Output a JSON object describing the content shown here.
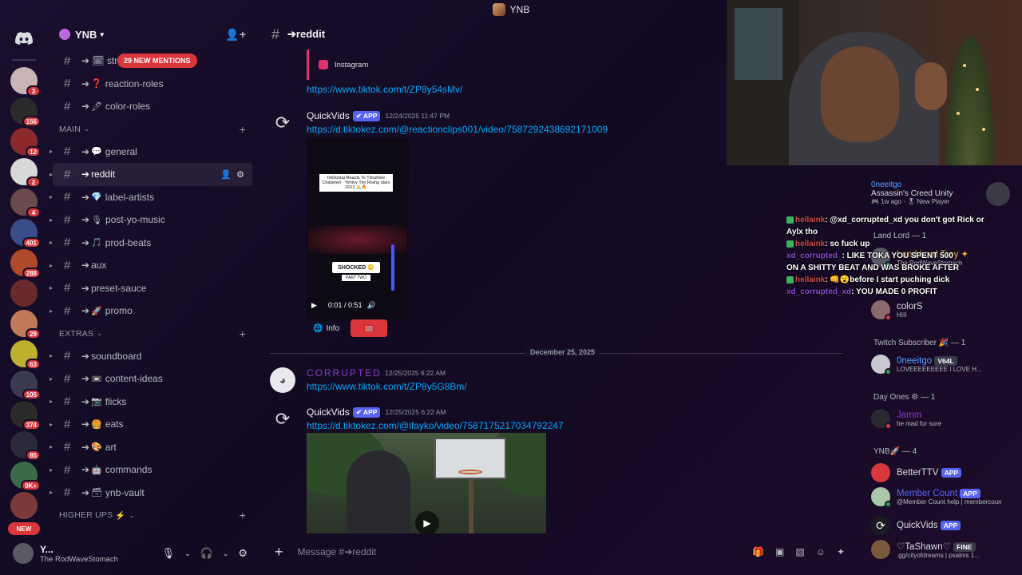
{
  "window": {
    "title": "YNB"
  },
  "rail": {
    "servers": [
      {
        "badge": "3",
        "color": "#c9b5b5"
      },
      {
        "badge": "156",
        "color": "#2b2b2b"
      },
      {
        "badge": "12",
        "color": "#8a2a2a"
      },
      {
        "badge": "2",
        "color": "#d8d8d8"
      },
      {
        "badge": "4",
        "color": "#6a4a4a"
      },
      {
        "badge": "401",
        "color": "#3a4c8a"
      },
      {
        "badge": "288",
        "color": "#b04a2a"
      },
      {
        "badge": "",
        "color": "#6a2a2a"
      },
      {
        "badge": "29",
        "color": "#c07a5a"
      },
      {
        "badge": "63",
        "color": "#c0b030"
      },
      {
        "badge": "105",
        "color": "#3a3a50"
      },
      {
        "badge": "374",
        "color": "#2a2a2a"
      },
      {
        "badge": "85",
        "color": "#2a2a3a"
      },
      {
        "badge": "9K+",
        "color": "#3a6a4a"
      },
      {
        "badge": "",
        "color": "#7a3a3a"
      }
    ],
    "new_label": "NEW"
  },
  "sidebar": {
    "server_name": "YNB",
    "mentions_pill": "29 NEW MENTIONS",
    "top_channels": [
      {
        "emoji": "🗓",
        "name": "➔ 🗓 stre..."
      },
      {
        "emoji": "❓",
        "name": "reaction-roles"
      },
      {
        "emoji": "🖊",
        "name": "color-roles"
      }
    ],
    "categories": {
      "main": "MAIN",
      "extras": "EXTRAS",
      "higher_ups": "HIGHER UPS"
    },
    "main_channels": [
      {
        "emoji": "💬",
        "name": "general"
      },
      {
        "emoji": "",
        "name": "reddit"
      },
      {
        "emoji": "💎",
        "name": "label-artists"
      },
      {
        "emoji": "🎙",
        "name": "post-yo-music"
      },
      {
        "emoji": "🎵",
        "name": "prod-beats"
      },
      {
        "emoji": "",
        "name": "aux"
      },
      {
        "emoji": "",
        "name": "preset-sauce"
      },
      {
        "emoji": "🚀",
        "name": "promo"
      }
    ],
    "extras_channels": [
      {
        "emoji": "",
        "name": "soundboard"
      },
      {
        "emoji": "📼",
        "name": "content-ideas"
      },
      {
        "emoji": "📷",
        "name": "flicks"
      },
      {
        "emoji": "🍔",
        "name": "eats"
      },
      {
        "emoji": "🎨",
        "name": "art"
      },
      {
        "emoji": "🤖",
        "name": "commands"
      },
      {
        "emoji": "🗃",
        "name": "ynb-vault"
      }
    ]
  },
  "user": {
    "name": "Y...",
    "status": "The RodWaveStomach"
  },
  "channel": {
    "name": "➔reddit"
  },
  "messages": {
    "ig_embed_label": "Instagram",
    "link1": "https://www.tiktok.com/t/ZP8y54sMv/",
    "msg1": {
      "author": "QuickVids",
      "tag": "APP",
      "time": "12/24/2025 11:47 PM",
      "link": "https://d.tiktokez.com/@reactionclips001/video/7587292438692171009"
    },
    "video1": {
      "caption": "ImDontai Reacts To Timothée Chalamet - Timmy Tim Rising stars 2012 🙏🔥",
      "shocked": "SHOCKED 😳",
      "part": "PART TWO",
      "time": "0:01 / 0:51",
      "info_label": "Info"
    },
    "date_divider": "December 25, 2025",
    "msg2": {
      "author": "CORRUPTED",
      "time": "12/25/2025 6:22 AM",
      "link": "https://www.tiktok.com/t/ZP8y5G8Bm/"
    },
    "msg3": {
      "author": "QuickVids",
      "tag": "APP",
      "time": "12/25/2025 6:22 AM",
      "link": "https://d.tiktokez.com/@ifayko/video/7587175217034792247"
    }
  },
  "composer": {
    "placeholder": "Message #➔reddit"
  },
  "members": {
    "top": {
      "name": "0neeitgo",
      "activity": "Assassin's Creed Unity",
      "meta": "🎮 1w ago · 🎖 New Player"
    },
    "groups": [
      {
        "label": "Land Lord — 1"
      },
      {
        "label": "Twitch Subscriber 🎉 — 1"
      },
      {
        "label": "Day Ones ⚙ — 1"
      },
      {
        "label": "YNB🚀 — 4"
      }
    ],
    "items": [
      {
        "name": "Land Lord Trey ✦",
        "sub": "The RodWaveStomach"
      },
      {
        "name": "colorS",
        "sub": "HIII"
      },
      {
        "name": "0neeitgo",
        "tag": "V64L",
        "sub": "LOVEEEEEEEEE I LOVE H..."
      },
      {
        "name": "Jamm",
        "sub": "he mad for sure"
      },
      {
        "name": "BetterTTV",
        "tag": "APP"
      },
      {
        "name": "Member Count",
        "tag": "APP",
        "sub": "@Member Count help | membercoun"
      },
      {
        "name": "QuickVids",
        "tag": "APP"
      },
      {
        "name": "♡TaShawn♡",
        "tag": "FINE",
        "sub": ".gg/cityofdreams | psalms 1..."
      }
    ]
  },
  "overlay": {
    "lines": [
      {
        "user": "hellaink",
        "text": ": @xd_corrupted_xd you don't got Rick or"
      },
      {
        "user": "",
        "text": "Aylx tho"
      },
      {
        "user": "hellaink",
        "text": ": so fuck up"
      },
      {
        "user": "xd_corrupted_",
        "text": ": LIKE TOKA YOU SPENT 500"
      },
      {
        "user": "",
        "text": "ON A SHITTY BEAT AND WAS BROKE AFTER"
      },
      {
        "user": "hellaink",
        "text": ": 👊😮before I start puching dick"
      },
      {
        "user": "xd_corrupted_xd",
        "text": ": YOU MADE 0 PROFIT"
      }
    ]
  },
  "colors": {
    "accent": "#5865f2",
    "danger": "#da373c",
    "link": "#00a8fc"
  }
}
